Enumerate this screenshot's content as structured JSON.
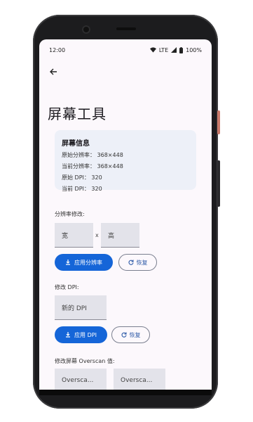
{
  "status_bar": {
    "time": "12:00",
    "network": "LTE",
    "battery": "100%"
  },
  "nav": {
    "back_icon": "arrow-left-icon"
  },
  "page": {
    "title": "屏幕工具"
  },
  "info_card": {
    "title": "屏幕信息",
    "lines": [
      "原始分辨率： 368×448",
      "当前分辨率： 368×448",
      "原始 DPI： 320",
      "当前 DPI： 320"
    ]
  },
  "resolution": {
    "label": "分辨率修改:",
    "width_placeholder": "宽",
    "times": "x",
    "height_placeholder": "高",
    "apply_label": "应用分辨率",
    "reset_label": "恢复"
  },
  "dpi": {
    "label": "修改 DPI:",
    "placeholder": "新的 DPI",
    "apply_label": "应用 DPI",
    "reset_label": "恢复"
  },
  "overscan": {
    "label": "修改屏幕 Overscan 值:",
    "field1_placeholder": "Oversca...",
    "field2_placeholder": "Oversca..."
  },
  "colors": {
    "primary": "#1565d8",
    "card_bg": "#edf0f8",
    "screen_bg": "#fcf8fc"
  }
}
